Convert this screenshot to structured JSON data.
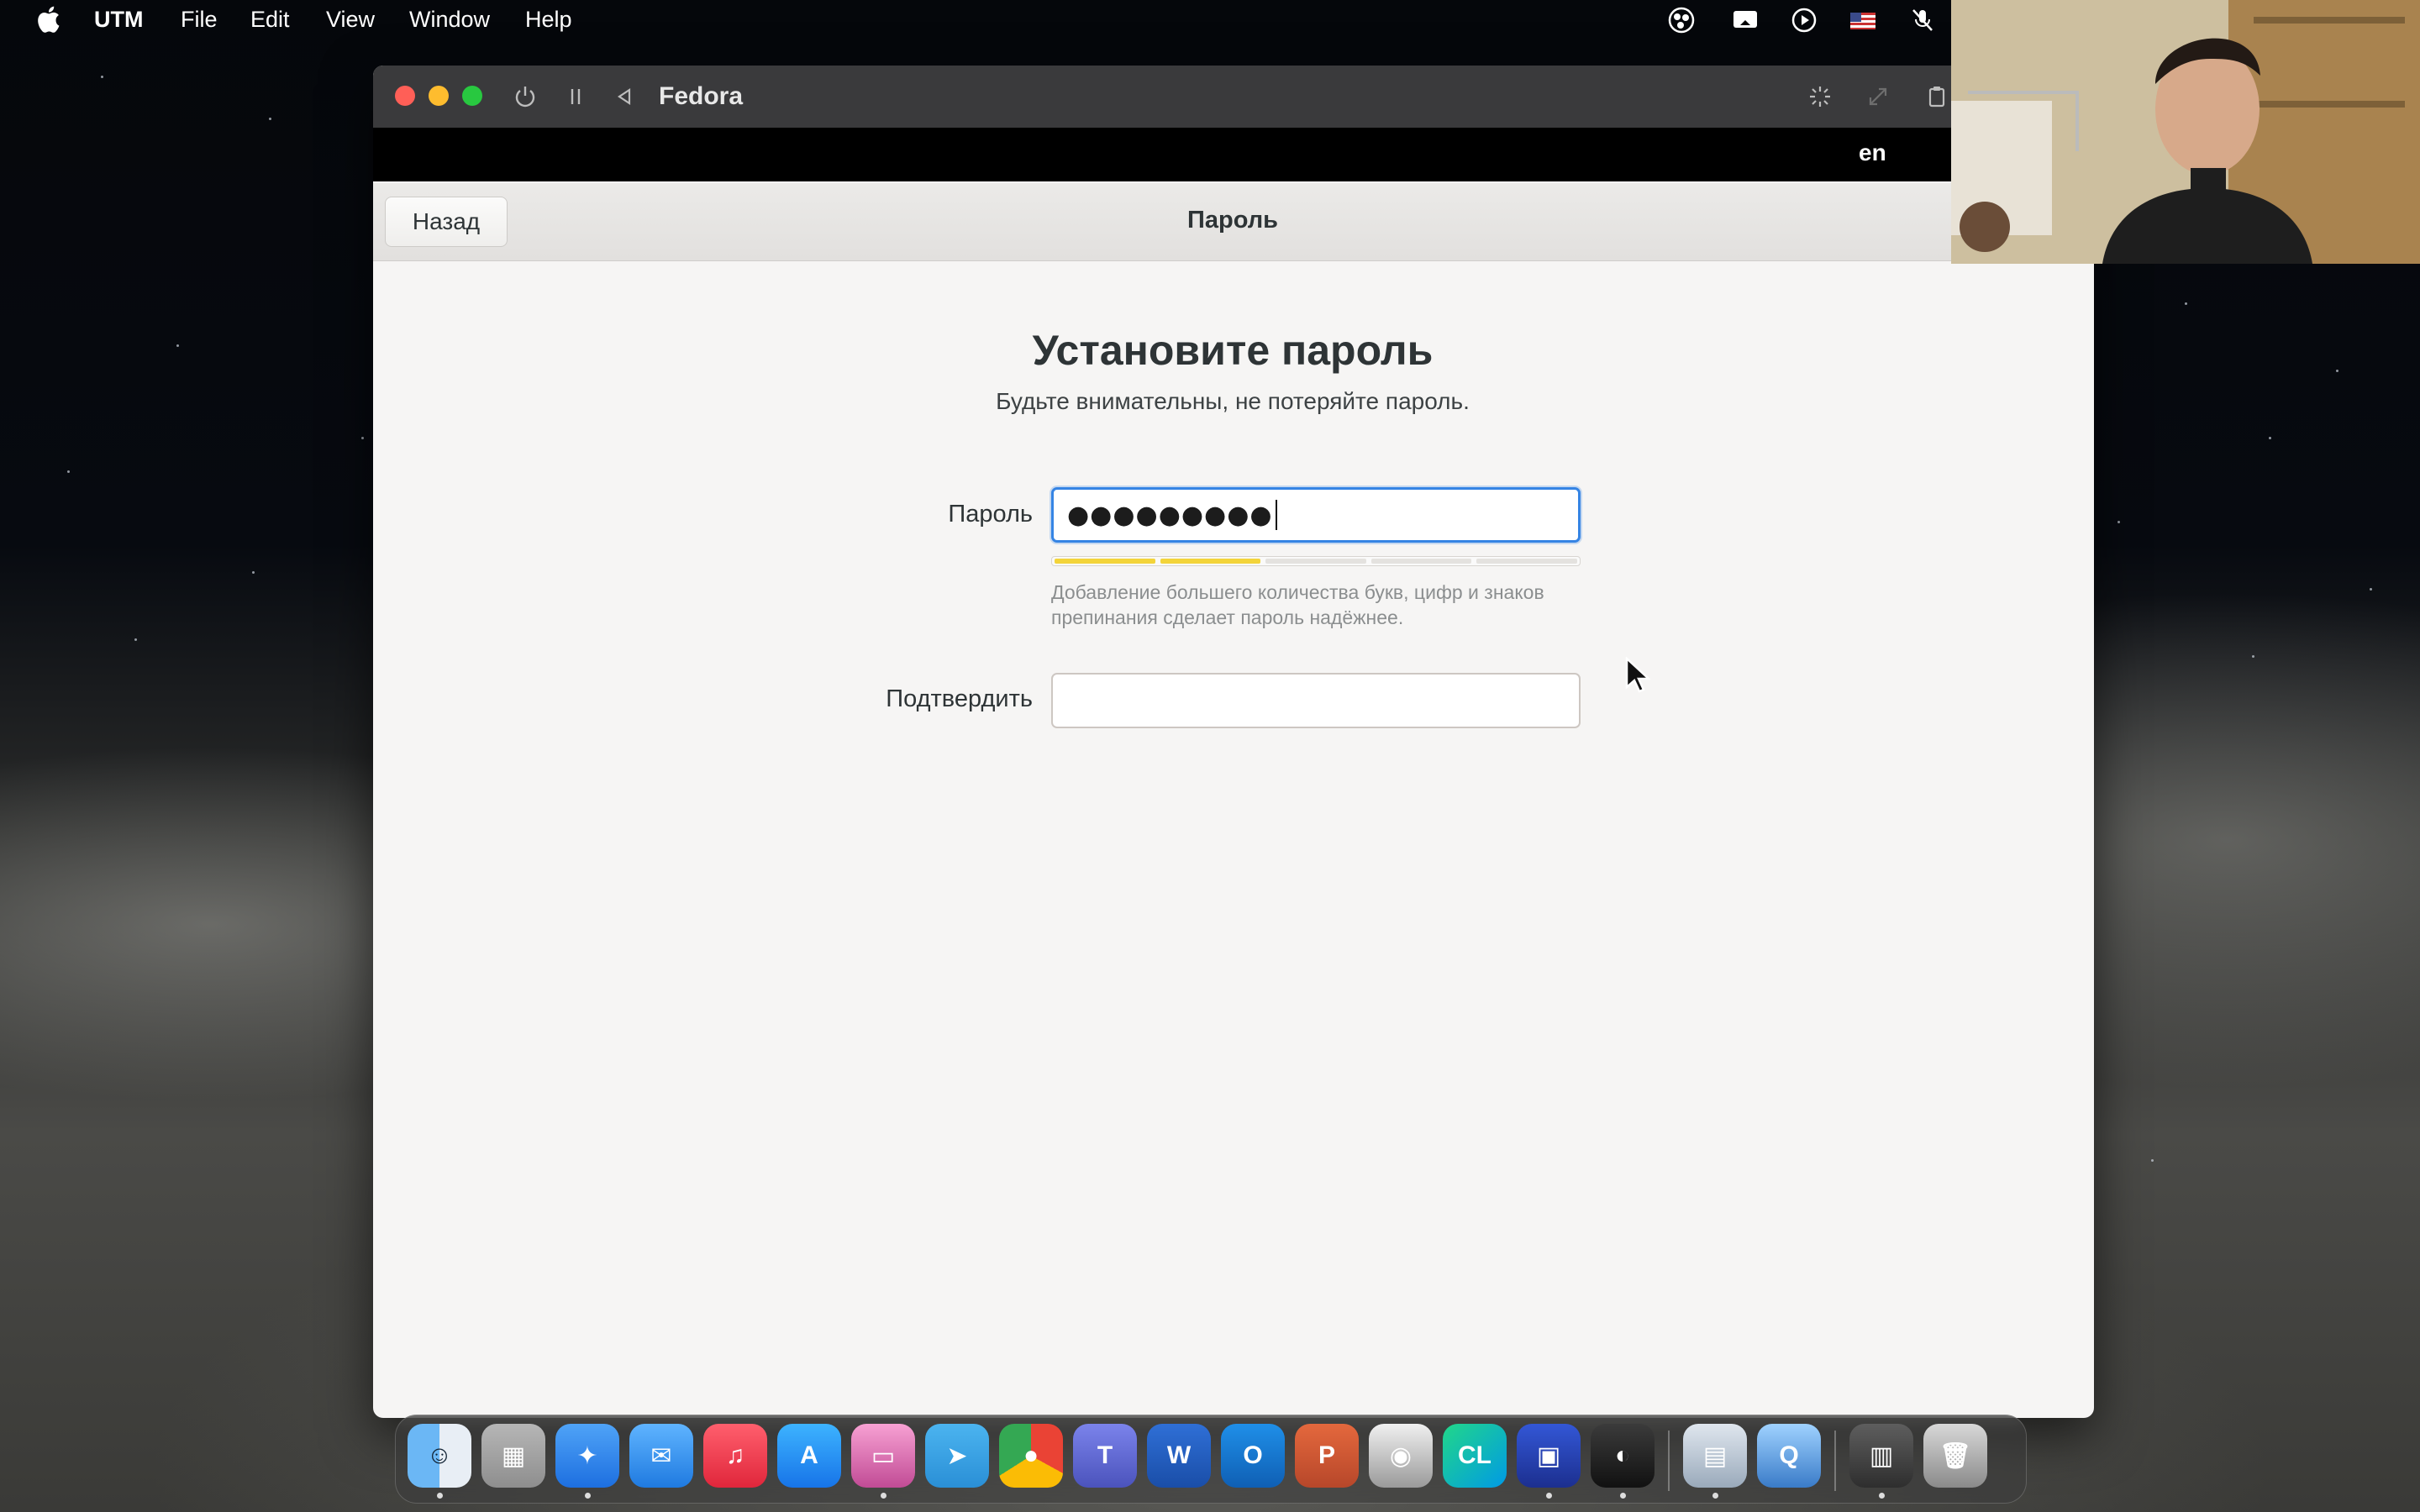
{
  "menubar": {
    "items": [
      "UTM",
      "File",
      "Edit",
      "View",
      "Window",
      "Help"
    ]
  },
  "status_icons": [
    "obs-icon",
    "screen-share-icon",
    "play-circle-icon",
    "us-flag-icon",
    "no-mic-icon"
  ],
  "window": {
    "title": "Fedora",
    "toolbar_icons": [
      "power-icon",
      "pause-icon",
      "back-triangle-icon",
      "brightness-icon",
      "resize-icon",
      "clipboard-icon"
    ]
  },
  "gnome_topbar": {
    "language": "en"
  },
  "header": {
    "back_label": "Назад",
    "title": "Пароль"
  },
  "page": {
    "heading": "Установите пароль",
    "subtitle": "Будьте внимательны, не потеряйте пароль."
  },
  "form": {
    "password_label": "Пароль",
    "password_value": "●●●●●●●●●",
    "strength_segments_total": 5,
    "strength_segments_filled": 2,
    "strength_color": "#f3d43a",
    "hint_line1": "Добавление большего количества букв, цифр и знаков",
    "hint_line2": "препинания сделает пароль надёжнее.",
    "confirm_label": "Подтвердить",
    "confirm_value": ""
  },
  "dock": {
    "apps": [
      "Finder",
      "Launchpad",
      "Safari",
      "Mail",
      "Music",
      "App Store",
      "UTM",
      "Telegram",
      "Chrome",
      "Teams",
      "Word",
      "Outlook",
      "PowerPoint",
      "Disk Utility",
      "CLion",
      "Frame",
      "OBS",
      "Preview",
      "QuickTime",
      "Screenshot",
      "Trash"
    ]
  },
  "colors": {
    "accent": "#3584e4",
    "close": "#ff5f57",
    "minimize": "#febc2e",
    "zoom": "#28c840"
  }
}
